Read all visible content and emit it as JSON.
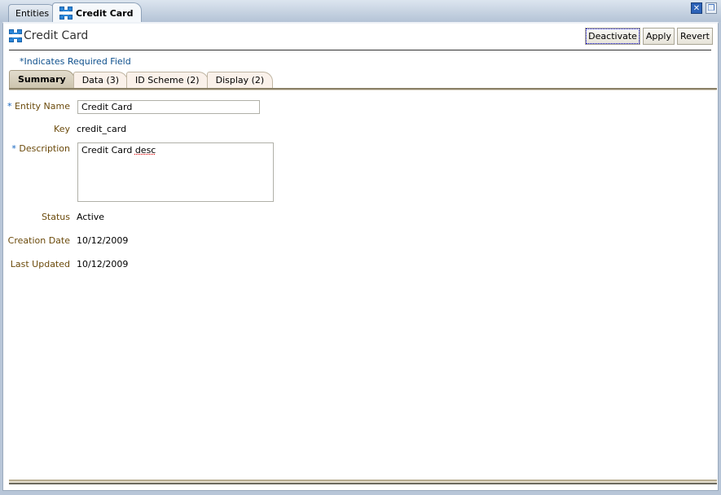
{
  "window_tabs": [
    {
      "label": "Entities",
      "active": false
    },
    {
      "label": "Credit Card",
      "active": true,
      "icon": "entity-icon"
    }
  ],
  "window_controls": {
    "close_icon": "close-icon",
    "restore_icon": "restore-icon"
  },
  "panel": {
    "title": "Credit Card",
    "title_icon": "entity-icon",
    "actions": {
      "deactivate": "Deactivate",
      "apply": "Apply",
      "revert": "Revert"
    },
    "required_note": "*Indicates Required Field"
  },
  "subtabs": [
    {
      "label": "Summary",
      "active": true
    },
    {
      "label": "Data (3)",
      "active": false
    },
    {
      "label": "ID Scheme (2)",
      "active": false
    },
    {
      "label": "Display (2)",
      "active": false
    }
  ],
  "form": {
    "required_mark": "*",
    "entity_name": {
      "label": "Entity Name",
      "value": "Credit Card"
    },
    "key": {
      "label": "Key",
      "value": "credit_card"
    },
    "description": {
      "label": "Description",
      "value_plain": "Credit Card ",
      "value_misspelled": "desc"
    },
    "status": {
      "label": "Status",
      "value": "Active"
    },
    "creation_date": {
      "label": "Creation Date",
      "value": "10/12/2009"
    },
    "last_updated": {
      "label": "Last Updated",
      "value": "10/12/2009"
    }
  }
}
